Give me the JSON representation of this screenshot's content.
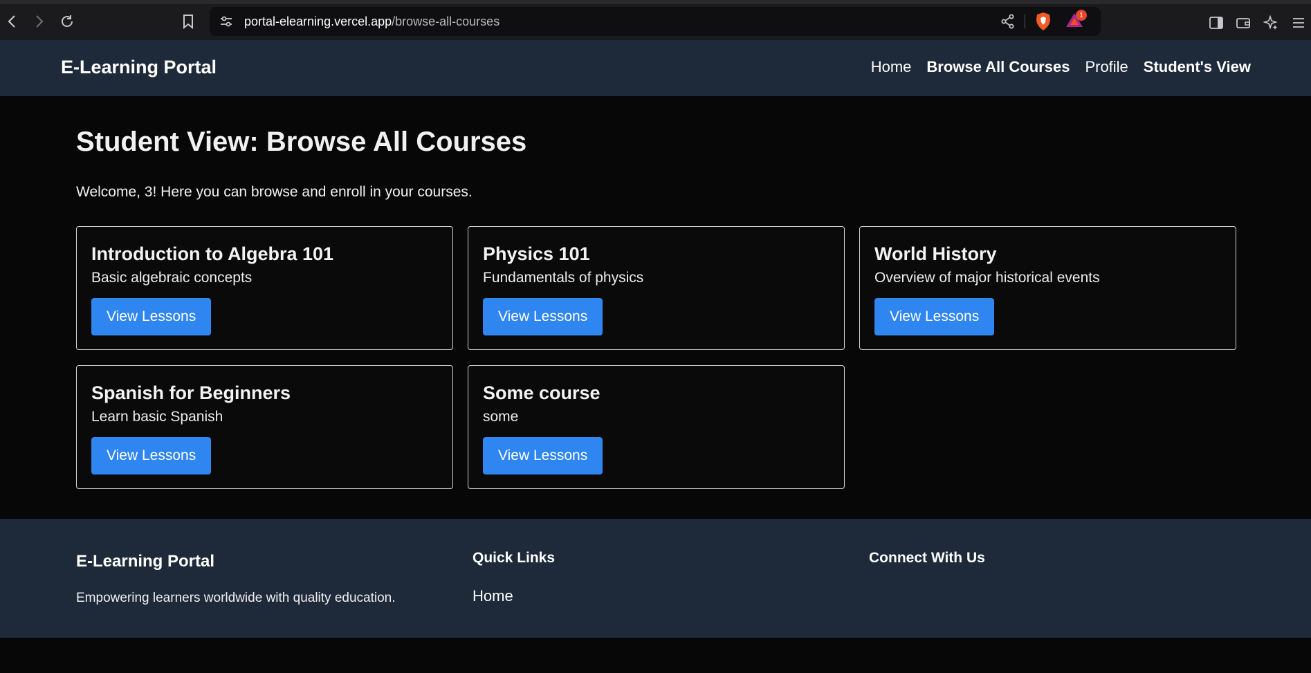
{
  "browser": {
    "url_host": "portal-elearning.vercel.app",
    "url_path": "/browse-all-courses",
    "notification_count": "1"
  },
  "header": {
    "brand": "E-Learning Portal",
    "nav": [
      "Home",
      "Browse All Courses",
      "Profile",
      "Student's View"
    ]
  },
  "main": {
    "title": "Student View: Browse All Courses",
    "welcome": "Welcome, 3! Here you can browse and enroll in your courses.",
    "courses": [
      {
        "title": "Introduction to Algebra 101",
        "description": "Basic algebraic concepts",
        "button": "View Lessons"
      },
      {
        "title": "Physics 101",
        "description": "Fundamentals of physics",
        "button": "View Lessons"
      },
      {
        "title": "World History",
        "description": "Overview of major historical events",
        "button": "View Lessons"
      },
      {
        "title": "Spanish for Beginners",
        "description": "Learn basic Spanish",
        "button": "View Lessons"
      },
      {
        "title": "Some course",
        "description": "some",
        "button": "View Lessons"
      }
    ]
  },
  "footer": {
    "brand": "E-Learning Portal",
    "tagline": "Empowering learners worldwide with quality education.",
    "quick_links_heading": "Quick Links",
    "quick_links": [
      "Home"
    ],
    "connect_heading": "Connect With Us"
  },
  "colors": {
    "header_bg": "#1e2a3a",
    "page_bg": "#070707",
    "button_blue": "#2f86f0"
  }
}
